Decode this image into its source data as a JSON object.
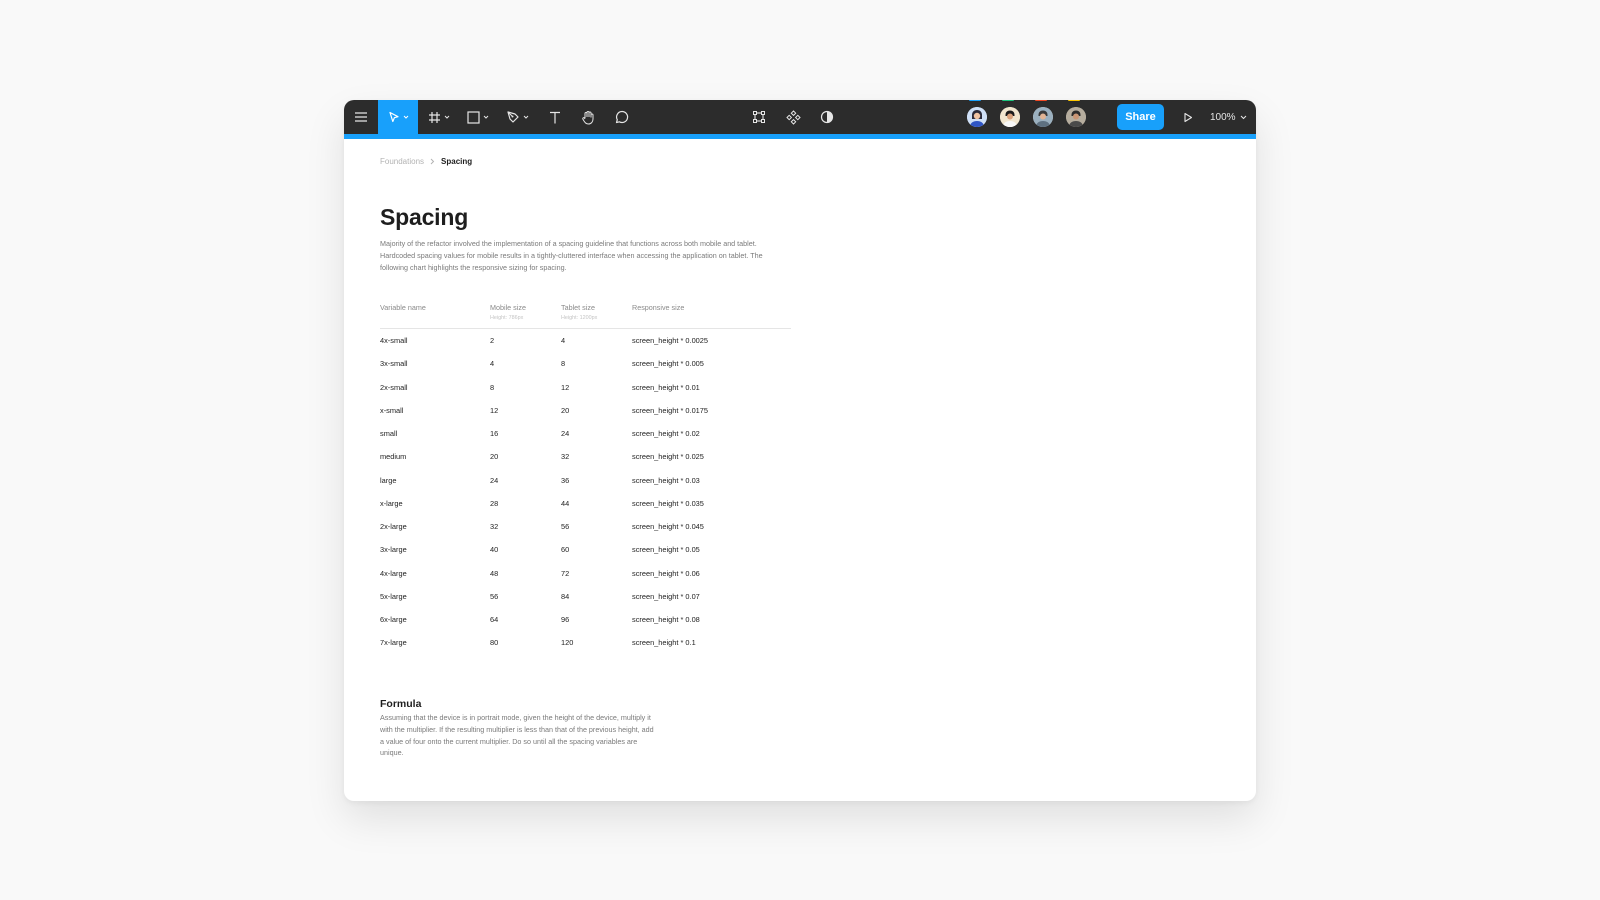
{
  "toolbar": {
    "tools": [
      {
        "name": "menu",
        "icon": "hamburger-icon"
      },
      {
        "name": "move",
        "icon": "cursor-icon",
        "active": true
      },
      {
        "name": "frame",
        "icon": "frame-icon"
      },
      {
        "name": "shape",
        "icon": "rectangle-icon"
      },
      {
        "name": "pen",
        "icon": "pen-icon"
      },
      {
        "name": "text",
        "icon": "text-icon"
      },
      {
        "name": "hand",
        "icon": "hand-icon"
      },
      {
        "name": "comment",
        "icon": "comment-icon"
      }
    ],
    "center_tools": [
      "transform-icon",
      "component-icon",
      "contrast-icon"
    ],
    "share_label": "Share",
    "zoom_label": "100%",
    "accent_color": "#18a0fb",
    "bar_color": "#2c2c2c"
  },
  "collaborators": [
    {
      "name": "collaborator-1",
      "color": "#18a0fb"
    },
    {
      "name": "collaborator-2",
      "color": "#1bc47d"
    },
    {
      "name": "collaborator-3",
      "color": "#f24822"
    },
    {
      "name": "collaborator-4",
      "color": "#ffc700"
    }
  ],
  "breadcrumb": {
    "parent": "Foundations",
    "current": "Spacing"
  },
  "page": {
    "title": "Spacing",
    "description": "Majority of the refactor involved the implementation of a spacing guideline that functions across both mobile and tablet. Hardcoded spacing values for mobile results in a tightly-cluttered interface when accessing the application on tablet. The following chart highlights the responsive sizing for spacing."
  },
  "table": {
    "headers": [
      {
        "label": "Variable name",
        "sub": ""
      },
      {
        "label": "Mobile size",
        "sub": "Height: 786px"
      },
      {
        "label": "Tablet size",
        "sub": "Height: 1200px"
      },
      {
        "label": "Responsive size",
        "sub": ""
      }
    ],
    "rows": [
      [
        "4x-small",
        "2",
        "4",
        "screen_height * 0.0025"
      ],
      [
        "3x-small",
        "4",
        "8",
        "screen_height * 0.005"
      ],
      [
        "2x-small",
        "8",
        "12",
        "screen_height * 0.01"
      ],
      [
        "x-small",
        "12",
        "20",
        "screen_height * 0.0175"
      ],
      [
        "small",
        "16",
        "24",
        "screen_height * 0.02"
      ],
      [
        "medium",
        "20",
        "32",
        "screen_height * 0.025"
      ],
      [
        "large",
        "24",
        "36",
        "screen_height * 0.03"
      ],
      [
        "x-large",
        "28",
        "44",
        "screen_height * 0.035"
      ],
      [
        "2x-large",
        "32",
        "56",
        "screen_height * 0.045"
      ],
      [
        "3x-large",
        "40",
        "60",
        "screen_height * 0.05"
      ],
      [
        "4x-large",
        "48",
        "72",
        "screen_height * 0.06"
      ],
      [
        "5x-large",
        "56",
        "84",
        "screen_height * 0.07"
      ],
      [
        "6x-large",
        "64",
        "96",
        "screen_height * 0.08"
      ],
      [
        "7x-large",
        "80",
        "120",
        "screen_height * 0.1"
      ]
    ]
  },
  "formula": {
    "title": "Formula",
    "description": "Assuming that the device is in portrait mode, given the height of the device, multiply it with the multiplier. If the resulting multiplier is less than that of the previous height, add a value of four onto the current multiplier. Do so until all the spacing variables are unique."
  }
}
